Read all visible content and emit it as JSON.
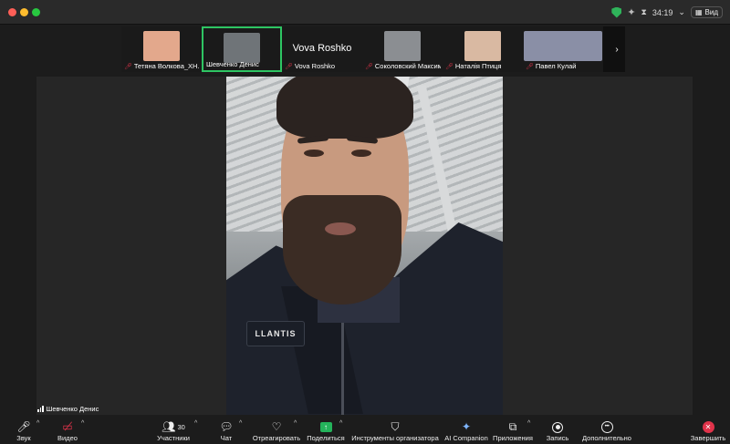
{
  "window": {
    "timer": "34:19",
    "view_label": "Вид"
  },
  "participants": [
    {
      "name": "Тетяна Волкова_ХН...",
      "muted": true,
      "face_color": "#e3a88c"
    },
    {
      "name": "Шевченко Денис",
      "muted": false,
      "active": true,
      "face_color": "#6f7478"
    },
    {
      "name": "Vova Roshko",
      "muted": true,
      "no_video": true
    },
    {
      "name": "Соколовский Максим",
      "muted": true,
      "face_color": "#8b8e92"
    },
    {
      "name": "Наталія Птиця",
      "muted": true,
      "face_color": "#d9b9a2"
    },
    {
      "name": "Павел Кулай",
      "muted": true,
      "face_color": "#8a8fa6"
    }
  ],
  "main_video": {
    "speaker_name": "Шевченко Денис",
    "jacket_logo": "LLANTIS"
  },
  "toolbar": {
    "audio": "Звук",
    "video": "Видео",
    "participants": "Участники",
    "participants_count": "30",
    "chat": "Чат",
    "react": "Отреагировать",
    "share": "Поделиться",
    "host_tools": "Инструменты организатора",
    "ai_companion": "AI Companion",
    "apps": "Приложения",
    "record": "Запись",
    "more": "Дополнительно",
    "end": "Завершить"
  },
  "colors": {
    "active_border": "#2ec563",
    "mute_red": "#e0334a",
    "share_green": "#24b35b"
  }
}
